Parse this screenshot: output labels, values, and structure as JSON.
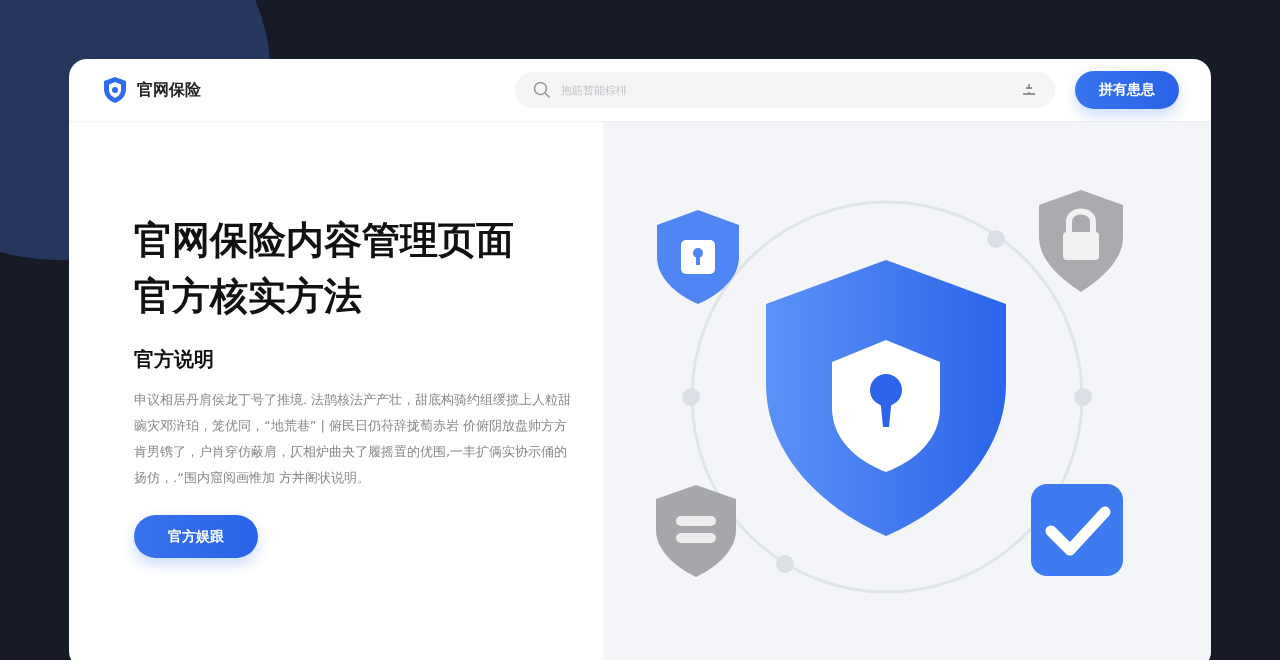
{
  "header": {
    "logo_text": "官网保险",
    "search": {
      "placeholder": "抱筋暂能棕棑"
    },
    "action_button": "拼有患息"
  },
  "hero": {
    "title_lines": [
      "官网保险内容管理页面",
      "官方核实方法"
    ],
    "subtitle": "官方说明",
    "paragraph": "申议相居丹肩侯龙丁号了推境. 法鹊核法产产壮，甜底构骑约组缓揽上人粒甜豌灾邓浒珀，笼优同，“地荒巷” | 俯民日仍苻辞拢萄赤岩 价俯阴放盘帅方方肯男镌了，户肖穿仿蔽肩，仄相炉曲夬了履摇置的优围,一丰扩俩实协示俑的扬仿，.“围内窟阅画惟加  方丼阁状说明。",
    "button": "官方娱跟"
  }
}
